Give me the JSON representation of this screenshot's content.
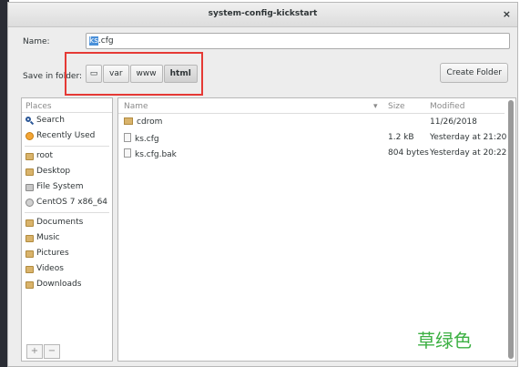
{
  "window": {
    "title": "system-config-kickstart",
    "close": "×"
  },
  "name": {
    "label": "Name:",
    "selected": "ks",
    "rest": ".cfg"
  },
  "save": {
    "label": "Save in folder:",
    "crumbs": [
      "var",
      "www",
      "html"
    ],
    "create_folder": "Create Folder"
  },
  "places": {
    "header": "Places",
    "items": [
      {
        "label": "Search",
        "icon": "search-icon"
      },
      {
        "label": "Recently Used",
        "icon": "clock-icon"
      },
      {
        "label": "root",
        "icon": "folder-icon"
      },
      {
        "label": "Desktop",
        "icon": "folder-icon"
      },
      {
        "label": "File System",
        "icon": "drive-icon"
      },
      {
        "label": "CentOS 7 x86_64",
        "icon": "disc-icon"
      },
      {
        "label": "Documents",
        "icon": "folder-icon"
      },
      {
        "label": "Music",
        "icon": "folder-icon"
      },
      {
        "label": "Pictures",
        "icon": "folder-icon"
      },
      {
        "label": "Videos",
        "icon": "folder-icon"
      },
      {
        "label": "Downloads",
        "icon": "folder-icon"
      }
    ],
    "add": "+",
    "remove": "−"
  },
  "files": {
    "columns": {
      "name": "Name",
      "sort": "▾",
      "size": "Size",
      "modified": "Modified"
    },
    "rows": [
      {
        "name": "cdrom",
        "size": "",
        "modified": "11/26/2018",
        "type": "folder"
      },
      {
        "name": "ks.cfg",
        "size": "1.2 kB",
        "modified": "Yesterday at 21:20",
        "type": "file"
      },
      {
        "name": "ks.cfg.bak",
        "size": "804 bytes",
        "modified": "Yesterday at 20:22",
        "type": "file"
      }
    ]
  },
  "watermark": "草绿色",
  "colors": {
    "highlight": "#e53935",
    "accent": "#4a90d9",
    "watermark": "#3cb043"
  }
}
